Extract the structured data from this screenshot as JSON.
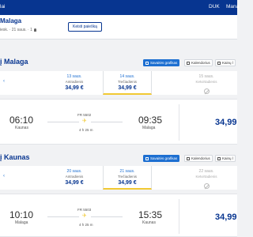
{
  "nav": {
    "brand": "lai",
    "links": [
      "DUK",
      "Mana"
    ]
  },
  "summary": {
    "route": "Malaga",
    "meta": "iesk. · 21 saus. · 1",
    "change_search_label": "Keisti paiešką"
  },
  "outbound": {
    "title": "į Malaga",
    "schedule_label": "Savaitės grafikas",
    "calendar_label": "Kalendorius",
    "fare_label": "Kainų l",
    "dates": [
      {
        "date": "13 saus.",
        "weekday": "Antradienis",
        "price": "34,99 €",
        "selected": false
      },
      {
        "date": "14 saus.",
        "weekday": "Trečiadienis",
        "price": "34,99 €",
        "selected": true
      },
      {
        "date": "15 saus.",
        "weekday": "Ketvirtadienis",
        "price": "",
        "selected": false,
        "no_flight": true
      }
    ],
    "flight": {
      "dep_time": "06:10",
      "dep_city": "Kaunas",
      "flight_no": "FR 5502",
      "duration": "4 h 25 m",
      "arr_time": "09:35",
      "arr_city": "Malaga",
      "price": "34,99"
    }
  },
  "inbound": {
    "title": "į Kaunas",
    "schedule_label": "Savaitės grafikas",
    "calendar_label": "Kalendorius",
    "fare_label": "Kainų l",
    "dates": [
      {
        "date": "20 saus.",
        "weekday": "Antradienis",
        "price": "34,99 €",
        "selected": false
      },
      {
        "date": "21 saus.",
        "weekday": "Trečiadienis",
        "price": "34,99 €",
        "selected": true
      },
      {
        "date": "22 saus.",
        "weekday": "Ketvirtadienis",
        "price": "",
        "selected": false,
        "no_flight": true
      }
    ],
    "flight": {
      "dep_time": "10:10",
      "dep_city": "Malaga",
      "flight_no": "FR 5503",
      "duration": "4 h 25 m",
      "arr_time": "15:35",
      "arr_city": "Kaunas",
      "price": "34,99"
    }
  },
  "colors": {
    "nav": "#073590",
    "accent": "#1d6fd1",
    "highlight": "#f1c933"
  }
}
